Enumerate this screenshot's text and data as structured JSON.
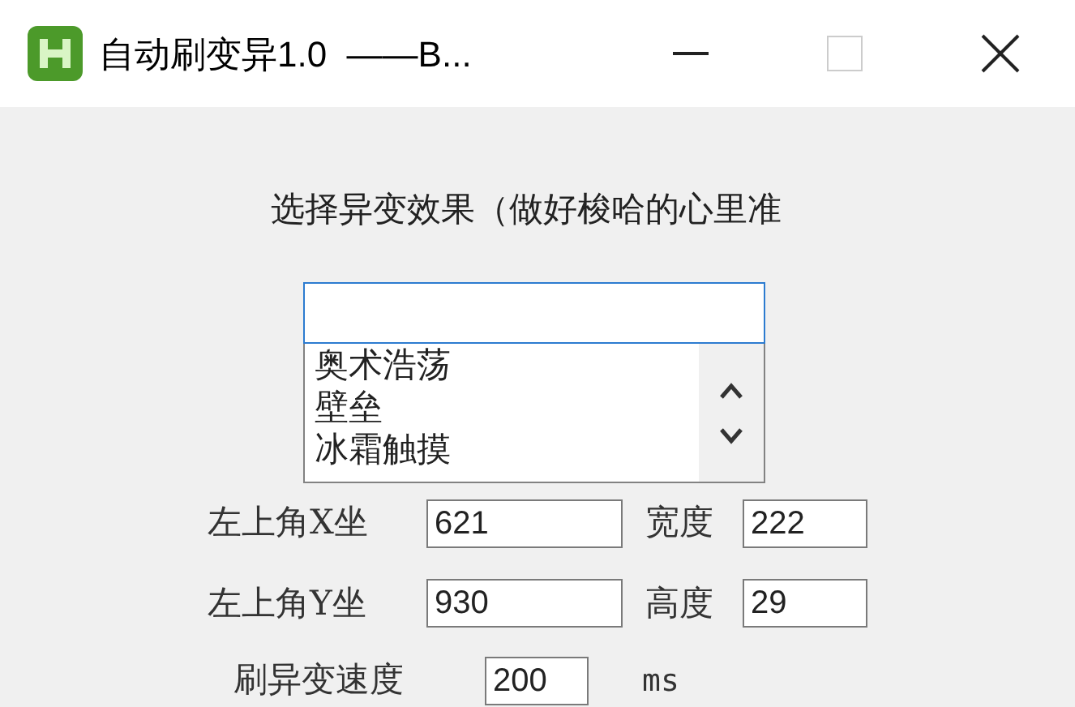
{
  "window": {
    "title": "自动刷变异1.0  ——B..."
  },
  "prompt": "选择异变效果（做好梭哈的心里准",
  "effects": [
    {
      "label": "奥术浩荡"
    },
    {
      "label": "壁垒"
    },
    {
      "label": "冰霜触摸"
    }
  ],
  "fields": [
    {
      "label": "左上角X坐",
      "value": "621",
      "label2": "宽度",
      "value2": "222"
    },
    {
      "label": "左上角Y坐",
      "value": "930",
      "label2": "高度",
      "value2": "29"
    }
  ],
  "speed": {
    "label": "刷异变速度",
    "value": "200",
    "unit": "ms"
  }
}
